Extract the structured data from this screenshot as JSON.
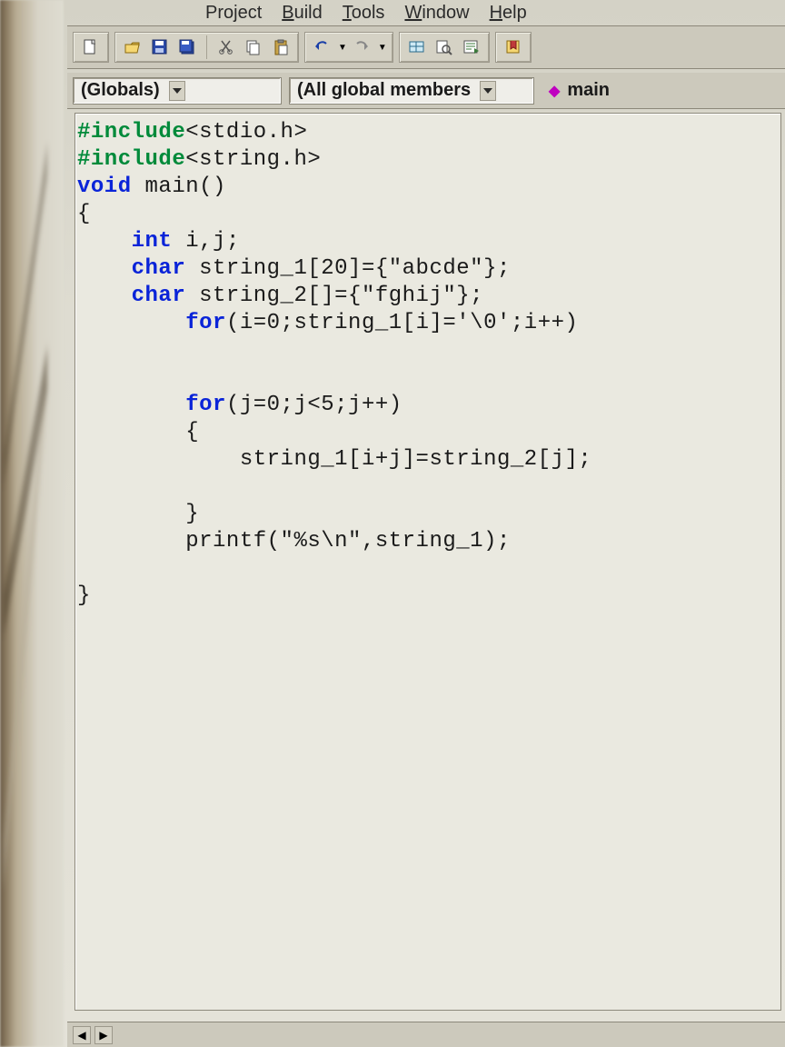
{
  "menu": {
    "items": [
      "Project",
      "Build",
      "Tools",
      "Window",
      "Help"
    ],
    "underline_index": [
      0,
      0,
      0,
      0,
      0
    ]
  },
  "toolbar": {
    "icons": [
      "new-file",
      "open",
      "save",
      "save-all",
      "cut",
      "copy",
      "paste",
      "undo",
      "redo",
      "find",
      "find-in-files",
      "output",
      "maximize"
    ]
  },
  "dropdowns": {
    "scope_label": "(Globals)",
    "members_label": "(All global members",
    "function_label": "main"
  },
  "code": {
    "lines": [
      {
        "t": "pp",
        "text": "#include"
      },
      {
        "t": "plain",
        "text": "<stdio.h>"
      },
      {
        "t": "nl"
      },
      {
        "t": "pp",
        "text": "#include"
      },
      {
        "t": "plain",
        "text": "<string.h>"
      },
      {
        "t": "nl"
      },
      {
        "t": "kw",
        "text": "void"
      },
      {
        "t": "plain",
        "text": " main()"
      },
      {
        "t": "nl"
      },
      {
        "t": "plain",
        "text": "{"
      },
      {
        "t": "nl"
      },
      {
        "t": "plain",
        "text": "    "
      },
      {
        "t": "kw",
        "text": "int"
      },
      {
        "t": "plain",
        "text": " i,j;"
      },
      {
        "t": "nl"
      },
      {
        "t": "plain",
        "text": "    "
      },
      {
        "t": "kw",
        "text": "char"
      },
      {
        "t": "plain",
        "text": " string_1[20]={\"abcde\"};"
      },
      {
        "t": "nl"
      },
      {
        "t": "plain",
        "text": "    "
      },
      {
        "t": "kw",
        "text": "char"
      },
      {
        "t": "plain",
        "text": " string_2[]={\"fghij\"};"
      },
      {
        "t": "nl"
      },
      {
        "t": "plain",
        "text": "        "
      },
      {
        "t": "kw",
        "text": "for"
      },
      {
        "t": "plain",
        "text": "(i=0;string_1[i]='\\0';i++)"
      },
      {
        "t": "nl"
      },
      {
        "t": "nl"
      },
      {
        "t": "nl"
      },
      {
        "t": "plain",
        "text": "        "
      },
      {
        "t": "kw",
        "text": "for"
      },
      {
        "t": "plain",
        "text": "(j=0;j<5;j++)"
      },
      {
        "t": "nl"
      },
      {
        "t": "plain",
        "text": "        {"
      },
      {
        "t": "nl"
      },
      {
        "t": "plain",
        "text": "            string_1[i+j]=string_2[j];"
      },
      {
        "t": "nl"
      },
      {
        "t": "nl"
      },
      {
        "t": "plain",
        "text": "        }"
      },
      {
        "t": "nl"
      },
      {
        "t": "plain",
        "text": "        printf(\"%s\\n\",string_1);"
      },
      {
        "t": "nl"
      },
      {
        "t": "nl"
      },
      {
        "t": "plain",
        "text": "}"
      }
    ]
  },
  "status": {
    "tabs": [
      "◀",
      "▶"
    ]
  }
}
